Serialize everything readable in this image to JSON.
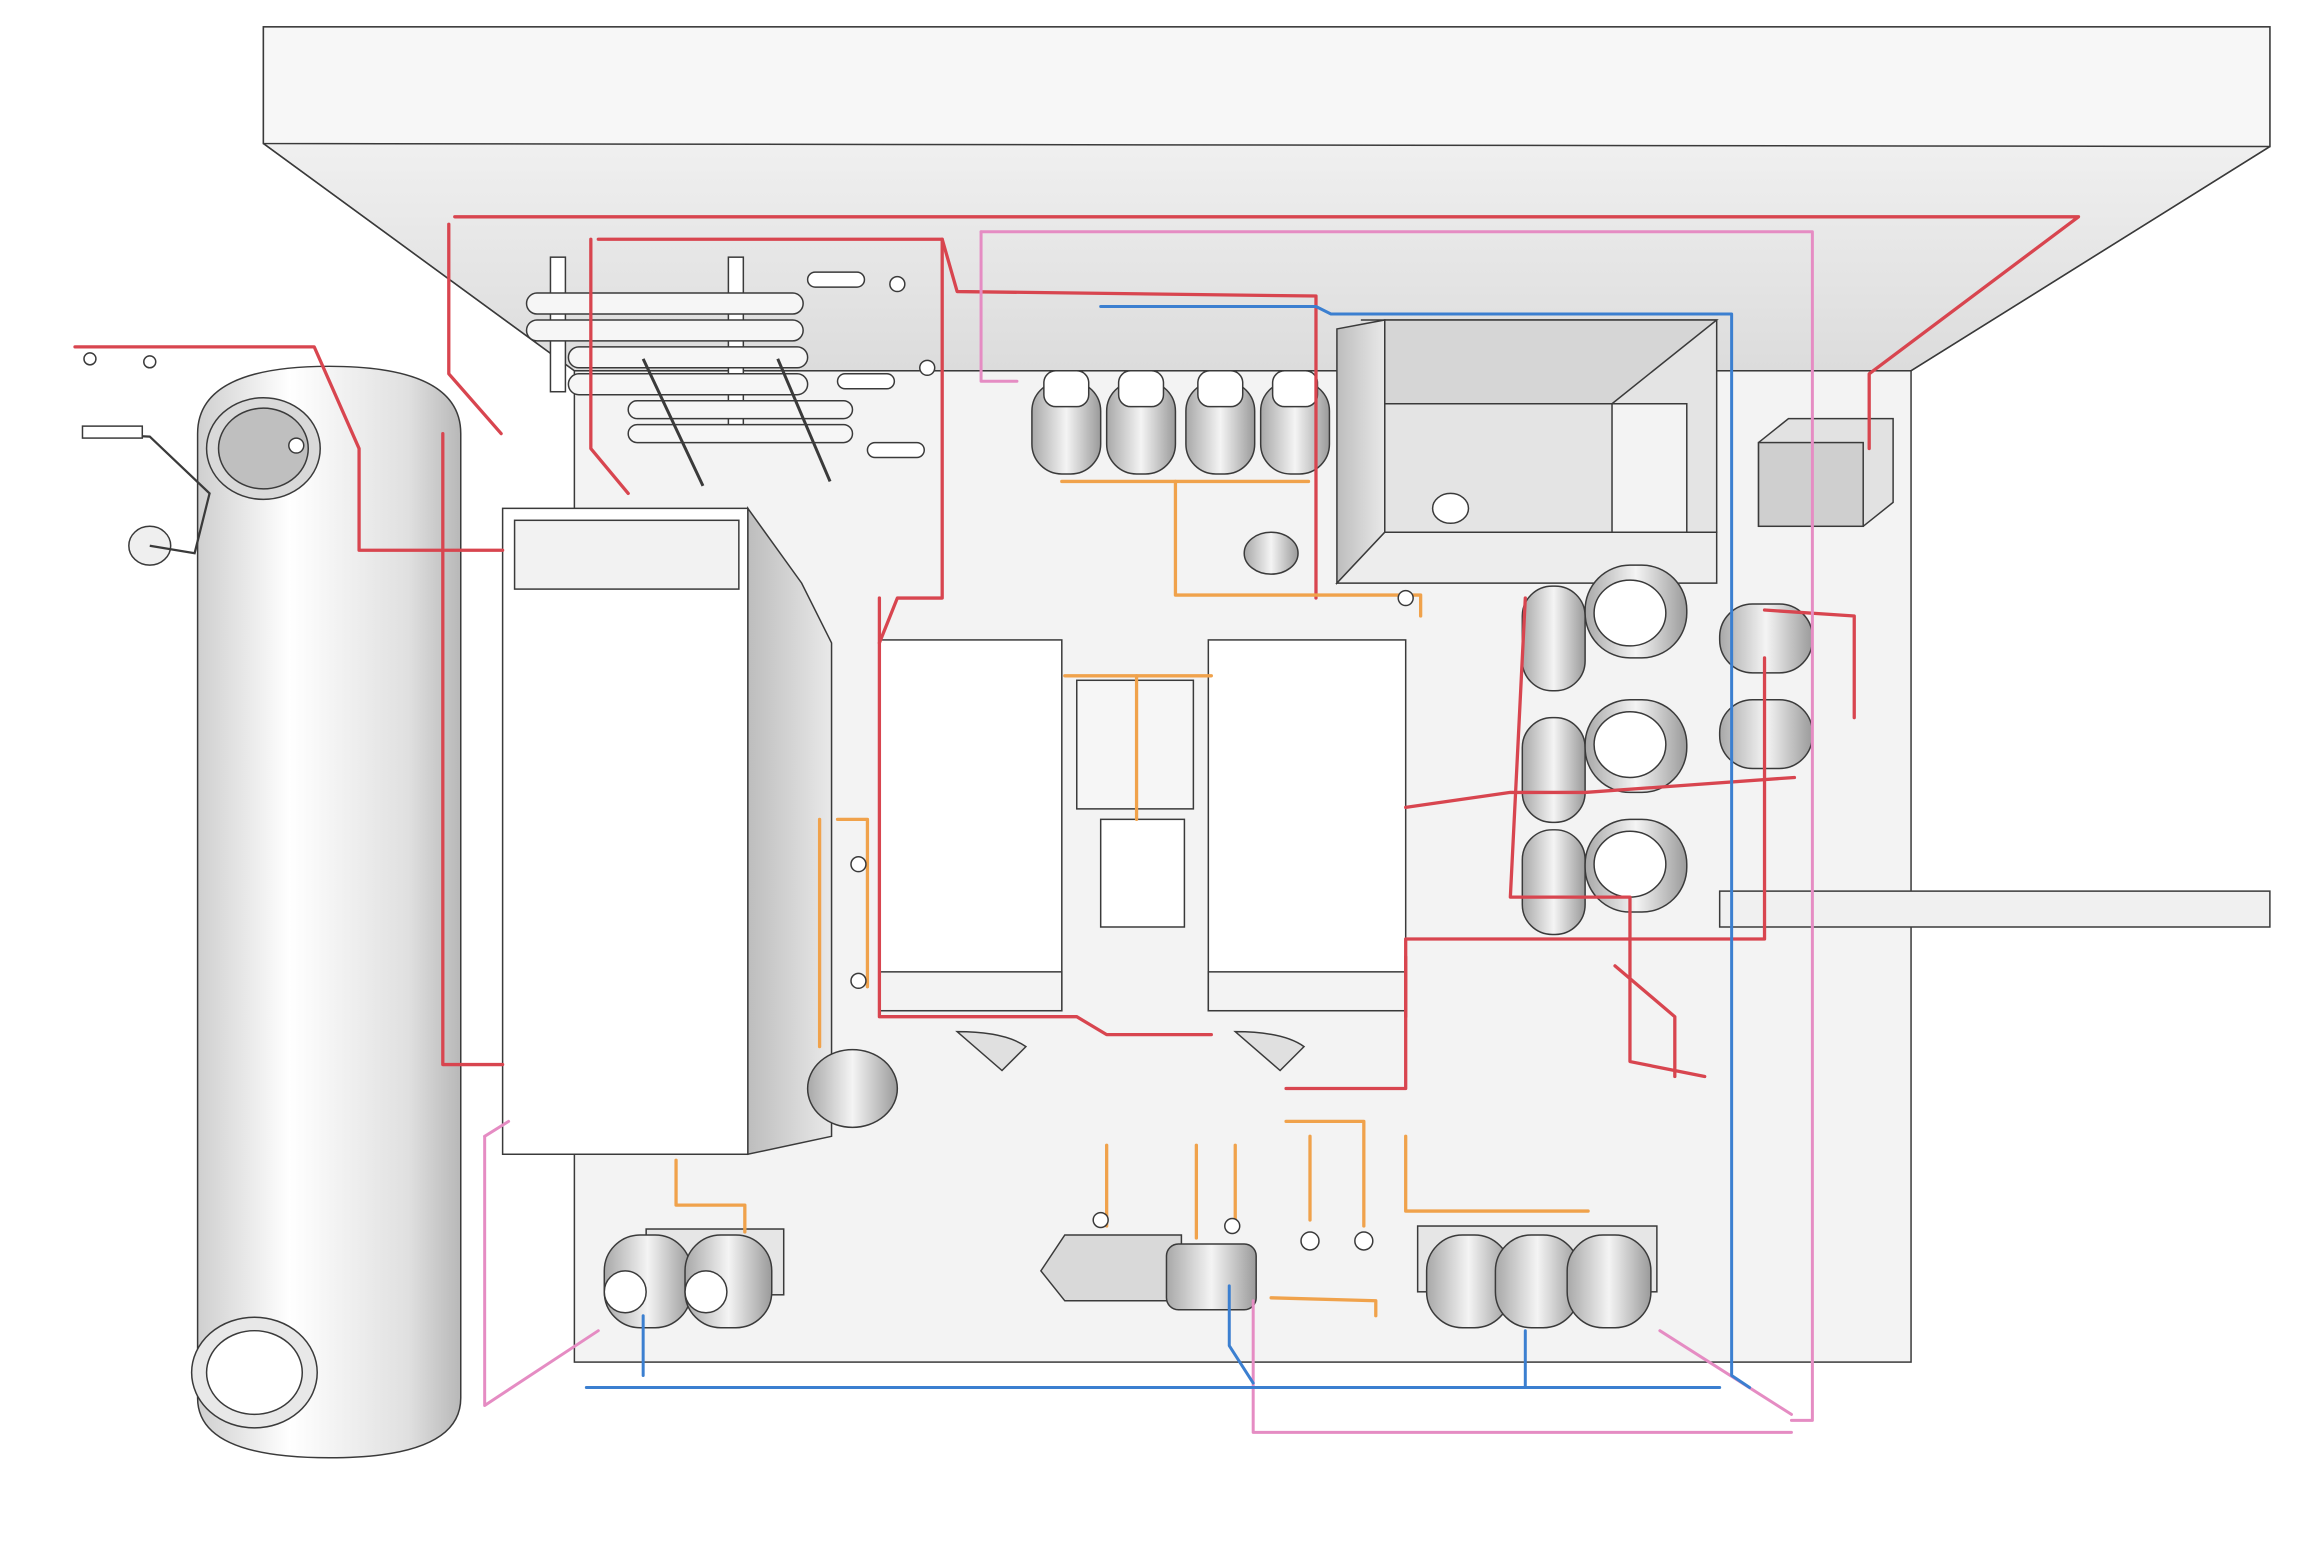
{
  "colors": {
    "background": "#ffffff",
    "floor": "#f2f2f2",
    "wall": "#e6e6e6",
    "equipment": "#ffffff",
    "outline": "#3a3a3a",
    "pipe_red": "#d8454f",
    "pipe_pink": "#e58cc3",
    "pipe_blue": "#3b7fd0",
    "pipe_orange": "#f0a24b"
  }
}
